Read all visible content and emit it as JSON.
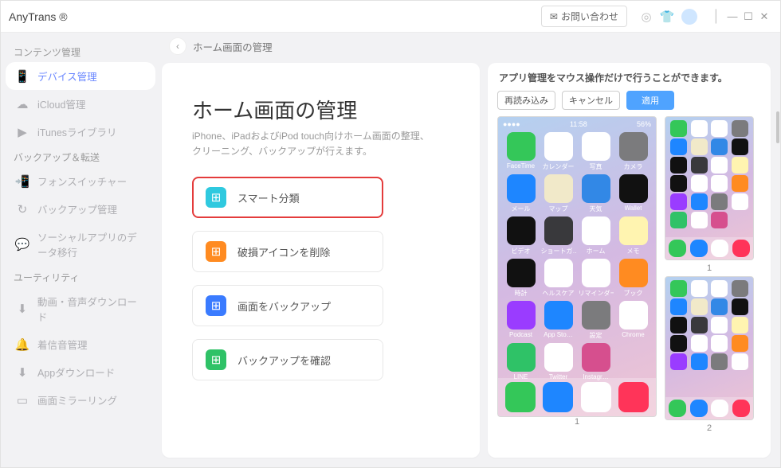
{
  "app_name": "AnyTrans ®",
  "header_btn": "お問い合わせ",
  "sidebar": {
    "groups": [
      {
        "heading": "コンテンツ管理",
        "items": [
          {
            "label": "デバイス管理",
            "icon": "📱",
            "active": true
          },
          {
            "label": "iCloud管理",
            "icon": "☁"
          },
          {
            "label": "iTunesライブラリ",
            "icon": "▶"
          }
        ]
      },
      {
        "heading": "バックアップ＆転送",
        "items": [
          {
            "label": "フォンスイッチャー",
            "icon": "📲"
          },
          {
            "label": "バックアップ管理",
            "icon": "↻"
          },
          {
            "label": "ソーシャルアプリのデータ移行",
            "icon": "💬"
          }
        ]
      },
      {
        "heading": "ユーティリティ",
        "items": [
          {
            "label": "動画・音声ダウンロード",
            "icon": "⬇"
          },
          {
            "label": "着信音管理",
            "icon": "🔔"
          },
          {
            "label": "Appダウンロード",
            "icon": "⬇"
          },
          {
            "label": "画面ミラーリング",
            "icon": "▭"
          }
        ]
      }
    ]
  },
  "breadcrumb": "ホーム画面の管理",
  "panel": {
    "title": "ホーム画面の管理",
    "subtitle": "iPhone、iPadおよびiPod touch向けホーム画面の整理、クリーニング、バックアップが行えます。",
    "options": [
      {
        "label": "スマート分類",
        "highlight": true,
        "color": "ico-cyan"
      },
      {
        "label": "破損アイコンを削除",
        "highlight": false,
        "color": "ico-orange"
      },
      {
        "label": "画面をバックアップ",
        "highlight": false,
        "color": "ico-blue"
      },
      {
        "label": "バックアップを確認",
        "highlight": false,
        "color": "ico-green"
      }
    ]
  },
  "preview": {
    "hint": "アプリ管理をマウス操作だけで行うことができます。",
    "buttons": {
      "reload": "再読み込み",
      "cancel": "キャンセル",
      "apply": "適用"
    },
    "time": "11:58",
    "battery": "56%",
    "page_big": "1",
    "page_small_1": "1",
    "page_small_2": "2",
    "apps": [
      {
        "label": "FaceTime",
        "bg": "#34c759"
      },
      {
        "label": "カレンダー",
        "bg": "#ffffff"
      },
      {
        "label": "写真",
        "bg": "#ffffff"
      },
      {
        "label": "カメラ",
        "bg": "#7b7b7d"
      },
      {
        "label": "メール",
        "bg": "#1e86ff"
      },
      {
        "label": "マップ",
        "bg": "#f1e9c9"
      },
      {
        "label": "天気",
        "bg": "#3288e6"
      },
      {
        "label": "Wallet",
        "bg": "#111111"
      },
      {
        "label": "ビデオ",
        "bg": "#111111"
      },
      {
        "label": "ショートガ…",
        "bg": "#39393c"
      },
      {
        "label": "ホーム",
        "bg": "#ffffff"
      },
      {
        "label": "メモ",
        "bg": "#fff4b0"
      },
      {
        "label": "時計",
        "bg": "#111111"
      },
      {
        "label": "ヘルスケア",
        "bg": "#ffffff"
      },
      {
        "label": "リマインダー",
        "bg": "#ffffff"
      },
      {
        "label": "ブック",
        "bg": "#ff8b21"
      },
      {
        "label": "Podcast",
        "bg": "#9a3cff"
      },
      {
        "label": "App Sto…",
        "bg": "#1e86ff"
      },
      {
        "label": "設定",
        "bg": "#7b7b7d"
      },
      {
        "label": "Chrome",
        "bg": "#ffffff"
      },
      {
        "label": "LINE",
        "bg": "#2fc267"
      },
      {
        "label": "Twitter",
        "bg": "#ffffff"
      },
      {
        "label": "Instagr…",
        "bg": "#d64f8e"
      }
    ],
    "dock": [
      {
        "bg": "#34c759"
      },
      {
        "bg": "#1e86ff"
      },
      {
        "bg": "#ffffff"
      },
      {
        "bg": "#ff3459"
      }
    ]
  }
}
